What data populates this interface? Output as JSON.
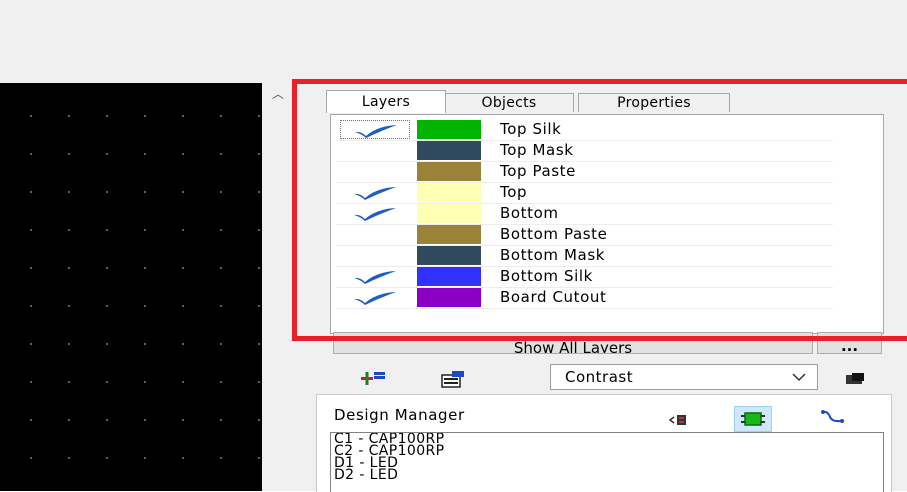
{
  "tabs": [
    {
      "label": "Layers",
      "active": true
    },
    {
      "label": "Objects",
      "active": false
    },
    {
      "label": "Properties",
      "active": false
    }
  ],
  "layers": [
    {
      "name": "Top Silk",
      "color": "#00b400",
      "checked": true
    },
    {
      "name": "Top Mask",
      "color": "#2e4a5c",
      "checked": false
    },
    {
      "name": "Top Paste",
      "color": "#9a8238",
      "checked": false
    },
    {
      "name": "Top",
      "color": "#ffffb4",
      "checked": true
    },
    {
      "name": "Bottom",
      "color": "#ffffb4",
      "checked": true
    },
    {
      "name": "Bottom Paste",
      "color": "#9a8238",
      "checked": false
    },
    {
      "name": "Bottom Mask",
      "color": "#2e4a5c",
      "checked": false
    },
    {
      "name": "Bottom Silk",
      "color": "#3030ff",
      "checked": true
    },
    {
      "name": "Board Cutout",
      "color": "#8a00c4",
      "checked": true
    }
  ],
  "buttons": {
    "show_all": "Show All Layers",
    "more": "..."
  },
  "toolbar": {
    "contrast_value": "Contrast"
  },
  "design_manager": {
    "title": "Design Manager",
    "items": [
      "C1 - CAP100RP",
      "C2 - CAP100RP",
      "D1 - LED",
      "D2 - LED"
    ]
  },
  "icons": {
    "checkmark": "checkmark-icon",
    "add_layer": "add-layer-icon",
    "layer_settings": "layer-settings-icon",
    "dropdown": "chevron-down-icon",
    "flip_view": "flip-view-icon",
    "collapse": "chevron-up-icon"
  },
  "colors": {
    "highlight": "#e8202a",
    "check": "#1f5fbf"
  }
}
